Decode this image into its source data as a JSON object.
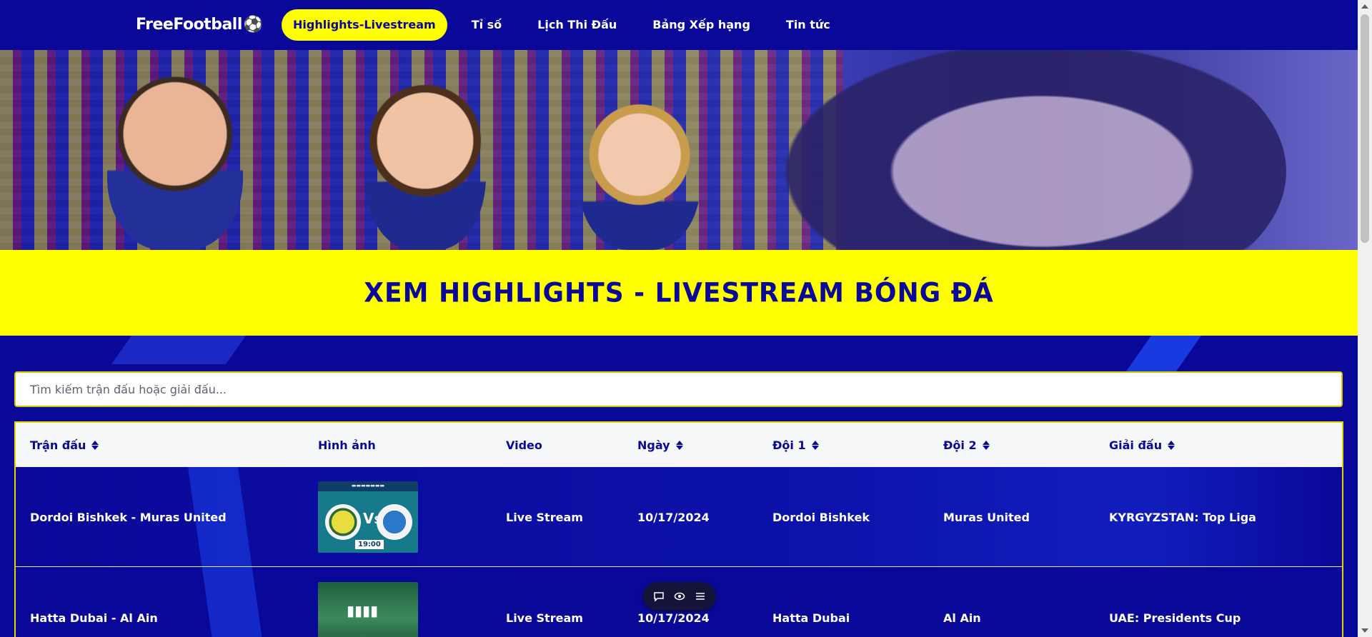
{
  "nav": {
    "logo": "FreeFootball",
    "logo_icon": "soccer-ball-icon",
    "links": [
      {
        "label": "Highlights-Livestream",
        "active": true
      },
      {
        "label": "Tỉ số",
        "active": false
      },
      {
        "label": "Lịch Thi Đấu",
        "active": false
      },
      {
        "label": "Bảng Xếp hạng",
        "active": false
      },
      {
        "label": "Tin tức",
        "active": false
      }
    ]
  },
  "banner": {
    "title": "XEM HIGHLIGHTS - LIVESTREAM BÓNG ĐÁ"
  },
  "search": {
    "placeholder": "Tìm kiếm trận đấu hoặc giải đấu..."
  },
  "table": {
    "headers": [
      {
        "label": "Trận đấu",
        "sortable": true
      },
      {
        "label": "Hình ảnh",
        "sortable": false
      },
      {
        "label": "Video",
        "sortable": false
      },
      {
        "label": "Ngày",
        "sortable": true
      },
      {
        "label": "Đội 1",
        "sortable": true
      },
      {
        "label": "Đội 2",
        "sortable": true
      },
      {
        "label": "Giải đấu",
        "sortable": true
      }
    ],
    "rows": [
      {
        "match": "Dordoi Bishkek - Muras United",
        "video": "Live Stream",
        "date": "10/17/2024",
        "team1": "Dordoi Bishkek",
        "team2": "Muras United",
        "league": "KYRGYZSTAN: Top Liga"
      },
      {
        "match": "Hatta Dubai - Al Ain",
        "video": "Live Stream",
        "date": "10/17/2024",
        "team1": "Hatta Dubai",
        "team2": "Al Ain",
        "league": "UAE: Presidents Cup"
      }
    ]
  },
  "colors": {
    "primary": "#0a0899",
    "accent": "#ffff00",
    "header_bg": "#f7f8fa"
  },
  "floating_toolbar": {
    "icons": [
      "chat-bubble-icon",
      "eye-toggle-icon",
      "menu-icon"
    ]
  }
}
